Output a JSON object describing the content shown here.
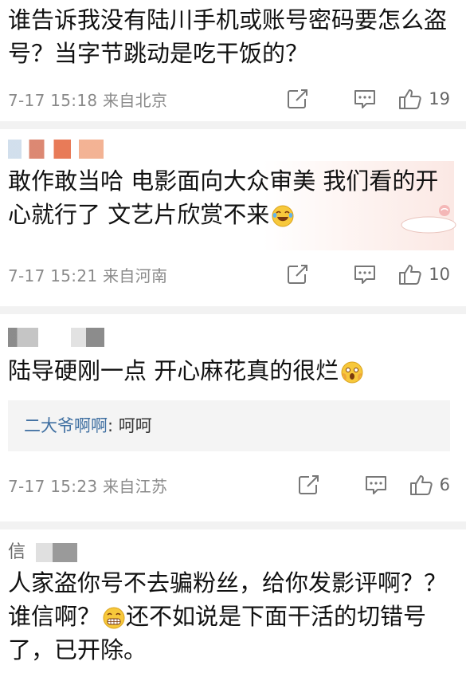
{
  "comments": [
    {
      "username": "",
      "text": "谁告诉我没有陆川手机或账号密码要怎么盗号？当字节跳动是吃干饭的？",
      "time": "7-17 15:18 来自北京",
      "likes": "19"
    },
    {
      "username": "",
      "text": "敢作敢当哈 电影面向大众审美 我们看的开心就行了 文艺片欣赏不来",
      "emoji": "laughing-tears-emoji",
      "time": "7-17 15:21 来自河南",
      "likes": "10"
    },
    {
      "username": "",
      "text": "陆导硬刚一点 开心麻花真的很烂",
      "emoji": "scared-face-emoji",
      "time": "7-17 15:23 来自江苏",
      "likes": "6",
      "reply": {
        "name": "二大爷啊啊",
        "text": ": 呵呵"
      }
    },
    {
      "username": "信",
      "text_part1": "人家盗你号不去骗粉丝，给你发影评啊？？谁信啊？",
      "emoji": "grin-emoji",
      "text_part2": "还不如说是下面干活的切错号了，已开除。"
    }
  ],
  "icons": {
    "share": "share-icon",
    "comment": "comment-icon",
    "like": "thumbs-up-icon"
  },
  "colors": {
    "meta_text": "#8a8a8a",
    "reply_name": "#3f6fa1",
    "separator": "#f2f2f2"
  }
}
